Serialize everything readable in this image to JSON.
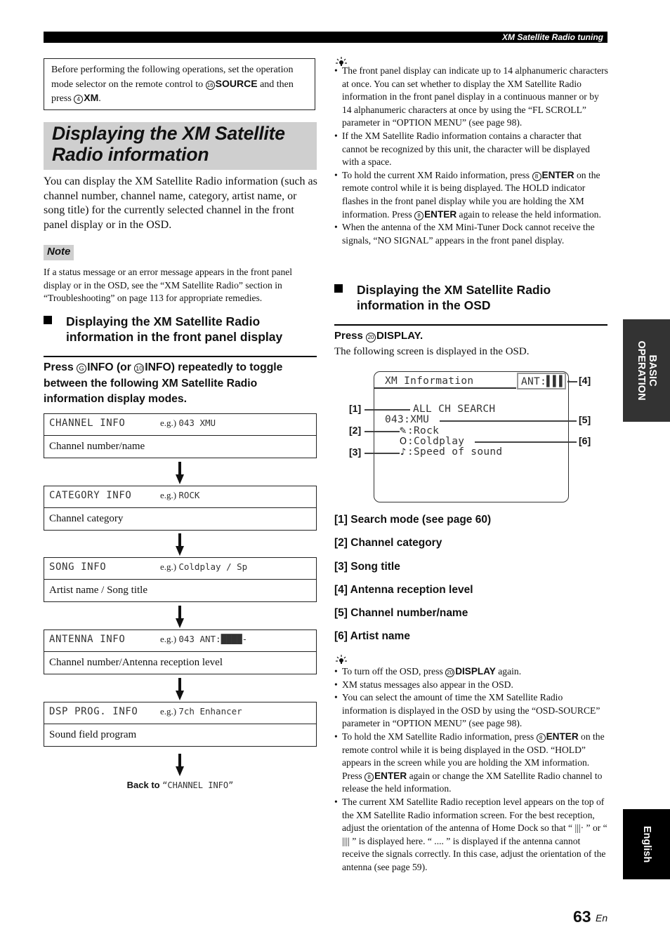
{
  "header": {
    "title": "XM Satellite Radio tuning"
  },
  "prerequisite": {
    "text_before": "Before performing the following operations, set the operation mode selector on the remote control to ",
    "key1_number": "16",
    "key1_label": "SOURCE",
    "text_middle": " and then press ",
    "key2_number": "4",
    "key2_label": "XM",
    "text_after": "."
  },
  "main_title": "Displaying the XM Satellite Radio information",
  "intro": "You can display the XM Satellite Radio information (such as channel number, channel name, category, artist name, or song title) for the currently selected channel in the front panel display or in the OSD.",
  "note": {
    "label": "Note",
    "text": "If a status message or an error message appears in the front panel display or in the OSD, see the “XM Satellite Radio” section in “Troubleshooting” on page 113 for appropriate remedies."
  },
  "front_panel": {
    "heading": "Displaying the XM Satellite Radio information in the front panel display",
    "instruction": {
      "press": "Press ",
      "key1": "G",
      "label1": "INFO",
      "or": " (or ",
      "key2": "10",
      "label2": "INFO",
      "rest": ") repeatedly to toggle between the following XM Satellite Radio information display modes."
    },
    "eg_label": "e.g.)",
    "modes": [
      {
        "name": "CHANNEL INFO",
        "example": "043 XMU",
        "description": "Channel number/name"
      },
      {
        "name": "CATEGORY INFO",
        "example": "ROCK",
        "description": "Channel category"
      },
      {
        "name": "SONG INFO",
        "example": "Coldplay / Sp",
        "description": "Artist name / Song title"
      },
      {
        "name": "ANTENNA INFO",
        "example": "043   ANT:████-",
        "description": "Channel number/Antenna reception level"
      },
      {
        "name": "DSP PROG. INFO",
        "example": "7ch Enhancer",
        "description": "Sound field program"
      }
    ],
    "back_to_label": "Back to ",
    "back_to_target": "“CHANNEL INFO”"
  },
  "tips_top": [
    "The front panel display can indicate up to 14 alphanumeric characters at once. You can set whether to display the XM Satellite Radio information in the front panel display in a continuous manner or by 14 alphanumeric characters at once by using the “FL SCROLL” parameter in “OPTION MENU” (see page 98).",
    "If the XM Satellite Radio information contains a character that cannot be recognized by this unit, the character will be displayed with a space.",
    {
      "a": "To hold the current XM Raido information, press ",
      "key": "8",
      "btn": "ENTER",
      "b": " on the remote control while it is being displayed. The HOLD indicator flashes in the front panel display while you are holding the XM information. Press ",
      "key2": "8",
      "btn2": "ENTER",
      "c": " again to release the held information."
    },
    "When the antenna of the XM Mini-Tuner Dock cannot receive the signals, “NO SIGNAL” appears in the front panel display."
  ],
  "osd": {
    "heading": "Displaying the XM Satellite Radio information in the OSD",
    "press": "Press ",
    "key": "20",
    "button": "DISPLAY",
    "press_end": ".",
    "follow_text": "The following screen is displayed in the OSD.",
    "screen": {
      "title": "XM Information",
      "ant": "ANT:▌▌▌·",
      "search_mode": "ALL CH SEARCH",
      "channel": "043:XMU",
      "category_icon": "guitar-icon",
      "category": ":Rock",
      "artist_icon": "person-icon",
      "artist": ":Coldplay",
      "song_icon": "music-note-icon",
      "song": ":Speed of sound"
    },
    "callouts": [
      "[1]",
      "[2]",
      "[3]",
      "[4]",
      "[5]",
      "[6]"
    ],
    "legend": [
      "[1] Search mode (see page 60)",
      "[2] Channel category",
      "[3] Song title",
      "[4] Antenna reception level",
      "[5] Channel number/name",
      "[6] Artist name"
    ]
  },
  "tips_bottom": [
    {
      "a": "To turn off the OSD, press ",
      "key": "20",
      "btn": "DISPLAY",
      "b": " again."
    },
    "XM status messages also appear in the OSD.",
    "You can select the amount of time the XM Satellite Radio information is displayed in the OSD by using the “OSD-SOURCE” parameter in “OPTION MENU” (see page 98).",
    {
      "a": "To hold the XM Satellite Radio information, press ",
      "key": "8",
      "btn": "ENTER",
      "b": " on the remote control while it is being displayed in the OSD. “HOLD” appears in the screen while you are holding the XM information. Press ",
      "key2": "8",
      "btn2": "ENTER",
      "c": " again or change the XM Satellite Radio channel to release the held information."
    },
    "The current XM Satellite Radio reception level appears on the top of the XM Satellite Radio information screen. For the best reception, adjust the orientation of the antenna of Home Dock so that “ |||· ” or “ |||| ” is displayed here. “ .... ” is displayed if the antenna cannot receive the signals correctly. In this case, adjust the orientation of the antenna (see page 59)."
  ],
  "side_tabs": {
    "section": "BASIC OPERATION",
    "language": "English"
  },
  "footer": {
    "page_number": "63",
    "lang_suffix": "En"
  }
}
